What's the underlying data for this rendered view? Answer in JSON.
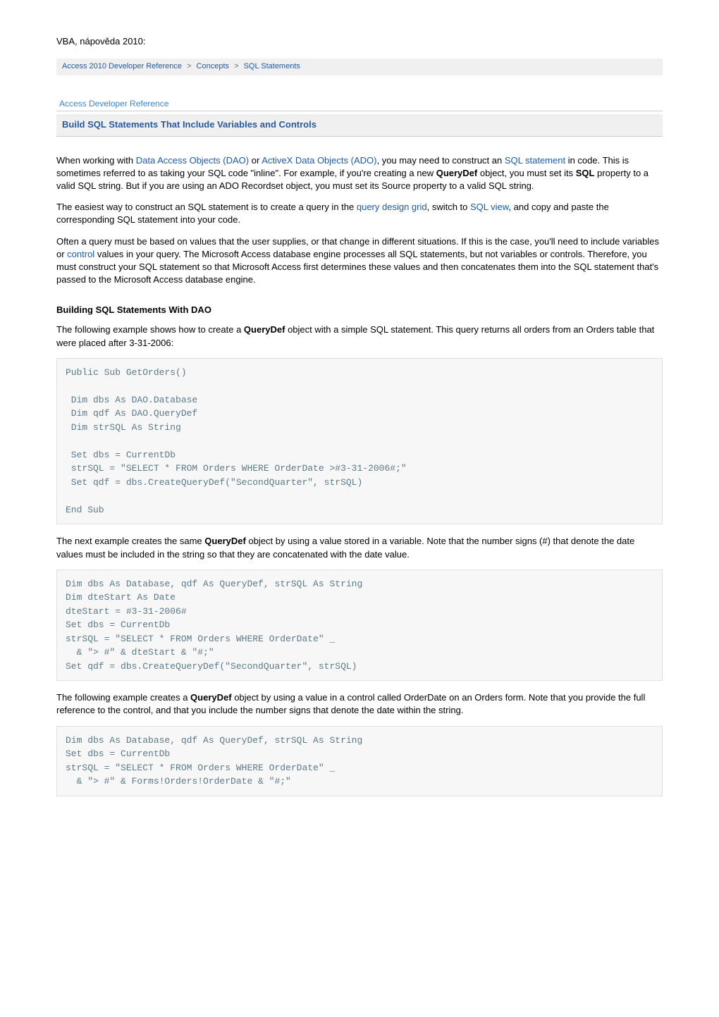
{
  "page_heading": "VBA, nápověda 2010:",
  "breadcrumb": {
    "items": [
      "Access 2010 Developer Reference",
      "Concepts",
      "SQL Statements"
    ]
  },
  "ref_label": "Access Developer Reference",
  "topic_title": "Build SQL Statements That Include Variables and Controls",
  "intro": {
    "p1_pre": "When working with ",
    "link_dao": "Data Access Objects (DAO)",
    "p1_mid1": " or ",
    "link_ado": "ActiveX Data Objects (ADO)",
    "p1_mid2": ", you may need to construct an ",
    "link_sql": "SQL statement",
    "p1_post": " in code. This is sometimes referred to as taking your SQL code \"inline\". For example, if you're creating a new ",
    "bold_qdef": "QueryDef",
    "p1_a": " object, you must set its ",
    "bold_sql": "SQL",
    "p1_b": " property to a valid SQL string. But if you are using an ADO Recordset object, you must set its Source property to a valid SQL string.",
    "p2_pre": "The easiest way to construct an SQL statement is to create a query in the ",
    "link_grid": "query design grid",
    "p2_mid": ", switch to ",
    "link_sqlview": "SQL view",
    "p2_post": ", and copy and paste the corresponding SQL statement into your code.",
    "p3_pre": "Often a query must be based on values that the user supplies, or that change in different situations. If this is the case, you'll need to include variables or ",
    "link_control": "control",
    "p3_post": " values in your query. The Microsoft Access database engine processes all SQL statements, but not variables or controls. Therefore, you must construct your SQL statement so that Microsoft Access first determines these values and then concatenates them into the SQL statement that's passed to the Microsoft Access database engine."
  },
  "section1": {
    "head": "Building SQL Statements With DAO",
    "p1_a": "The following example shows how to create a ",
    "p1_bold": "QueryDef",
    "p1_b": " object with a simple SQL statement. This query returns all orders from an Orders table that were placed after 3-31-2006:",
    "code1": "Public Sub GetOrders()\n\n Dim dbs As DAO.Database\n Dim qdf As DAO.QueryDef\n Dim strSQL As String\n\n Set dbs = CurrentDb\n strSQL = \"SELECT * FROM Orders WHERE OrderDate >#3-31-2006#;\"\n Set qdf = dbs.CreateQueryDef(\"SecondQuarter\", strSQL)\n\nEnd Sub",
    "p2_a": "The next example creates the same ",
    "p2_bold": "QueryDef",
    "p2_b": " object by using a value stored in a variable. Note that the number signs (#) that denote the date values must be included in the string so that they are concatenated with the date value.",
    "code2": "Dim dbs As Database, qdf As QueryDef, strSQL As String\nDim dteStart As Date\ndteStart = #3-31-2006#\nSet dbs = CurrentDb\nstrSQL = \"SELECT * FROM Orders WHERE OrderDate\" _\n  & \"> #\" & dteStart & \"#;\"\nSet qdf = dbs.CreateQueryDef(\"SecondQuarter\", strSQL)",
    "p3_a": "The following example creates a ",
    "p3_bold": "QueryDef",
    "p3_b": " object by using a value in a control called OrderDate on an Orders form. Note that you provide the full reference to the control, and that you include the number signs that denote the date within the string.",
    "code3": "Dim dbs As Database, qdf As QueryDef, strSQL As String\nSet dbs = CurrentDb\nstrSQL = \"SELECT * FROM Orders WHERE OrderDate\" _\n  & \"> #\" & Forms!Orders!OrderDate & \"#;\""
  }
}
